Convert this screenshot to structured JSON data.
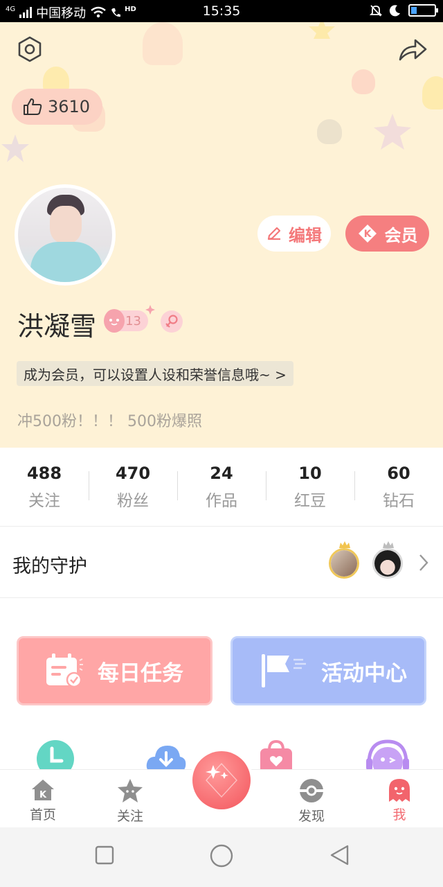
{
  "status_bar": {
    "network_type": "4G",
    "carrier": "中国移动",
    "hd_label": "HD",
    "time": "15:35",
    "battery_level": 0.25
  },
  "header": {
    "settings_icon": "hexagon-gear-icon",
    "share_icon": "share-arrow-icon",
    "likes_count": "3610",
    "edit_label": "编辑",
    "vip_label": "会员",
    "username": "洪凝雪",
    "level": "13",
    "gender": "female",
    "member_tip": "成为会员，可以设置人设和荣誉信息哦~ >",
    "bio": "冲500粉！！！ 500粉爆照",
    "background_color": "#fef2d6"
  },
  "stats": [
    {
      "value": "488",
      "label": "关注"
    },
    {
      "value": "470",
      "label": "粉丝"
    },
    {
      "value": "24",
      "label": "作品"
    },
    {
      "value": "10",
      "label": "红豆"
    },
    {
      "value": "60",
      "label": "钻石"
    }
  ],
  "guard": {
    "title": "我的守护"
  },
  "cards": {
    "daily_label": "每日任务",
    "activity_label": "活动中心",
    "daily_color": "#ffa6a6",
    "activity_color": "#a7bbf8"
  },
  "tabs": [
    {
      "label": "首页",
      "icon": "home-k-icon",
      "active": false
    },
    {
      "label": "关注",
      "icon": "star-face-icon",
      "active": false
    },
    {
      "label": "",
      "icon": "diamond-sparkle-icon",
      "active": false
    },
    {
      "label": "发现",
      "icon": "pokeball-icon",
      "active": false
    },
    {
      "label": "我",
      "icon": "ghost-icon",
      "active": true
    }
  ],
  "accent_color": "#f26b72"
}
